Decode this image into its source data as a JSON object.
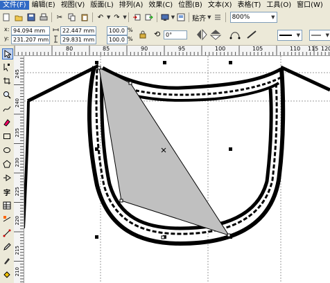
{
  "menu": {
    "items": [
      "文件(F)",
      "编辑(E)",
      "视图(V)",
      "版面(L)",
      "排列(A)",
      "效果(C)",
      "位图(B)",
      "文本(X)",
      "表格(T)",
      "工具(O)",
      "窗口(W)"
    ],
    "active_index": 0
  },
  "toolbar": {
    "align_label": "贴齐",
    "zoom_value": "800%"
  },
  "property_bar": {
    "x_label": "x:",
    "x_value": "94.094 mm",
    "y_label": "y:",
    "y_value": "231.207 mm",
    "width_value": "22.447 mm",
    "height_value": "29.831 mm",
    "scale_x": "100.0",
    "scale_y": "100.0",
    "percent_x": "%",
    "percent_y": "%",
    "rotation_value": "0",
    "rotation_unit": "°"
  },
  "ruler": {
    "h_ticks": [
      "80",
      "85",
      "90",
      "95",
      "100",
      "105",
      "110",
      "115",
      "120"
    ],
    "v_ticks": [
      "245",
      "240",
      "235",
      "230",
      "225",
      "220",
      "215",
      "210"
    ]
  },
  "colors": {
    "menu_bg": "#ece9d8",
    "selection_fill": "#c0c0c0",
    "outline": "#000000"
  }
}
